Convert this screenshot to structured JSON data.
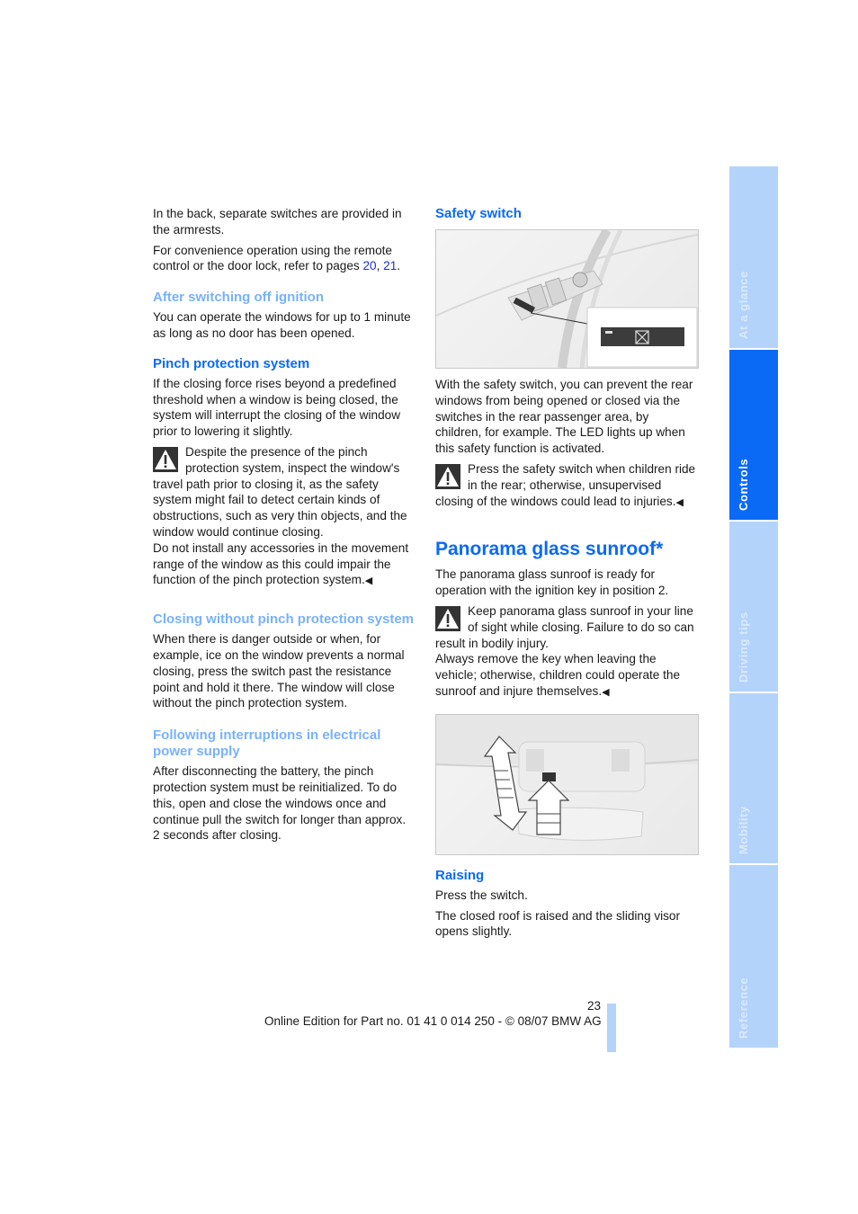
{
  "left_column": {
    "intro_p1": "In the back, separate switches are provided in the armrests.",
    "intro_p2_before": "For convenience operation using the remote control or the door lock, refer to pages ",
    "intro_p2_link1": "20",
    "intro_p2_sep": ", ",
    "intro_p2_link2": "21",
    "intro_p2_after": ".",
    "after_ignition": {
      "heading": "After switching off ignition",
      "text": "You can operate the windows for up to 1 minute as long as no door has been opened."
    },
    "pinch": {
      "heading": "Pinch protection system",
      "text": "If the closing force rises beyond a predefined threshold when a window is being closed, the system will interrupt the closing of the window prior to lowering it slightly.",
      "warning_p1": "Despite the presence of the pinch protection system, inspect the window's travel path prior to closing it, as the safety system might fail to detect certain kinds of obstructions, such as very thin objects, and the window would continue closing.",
      "warning_p2": "Do not install any accessories in the movement range of the window as this could impair the function of the pinch protection system.",
      "end_mark": "◀"
    },
    "closing_without": {
      "heading": "Closing without pinch protection system",
      "text": "When there is danger outside or when, for example, ice on the window prevents a normal closing, press the switch past the resistance point and hold it there. The window will close without the pinch protection system."
    },
    "following": {
      "heading": "Following interruptions in electrical power supply",
      "text": "After disconnecting the battery, the pinch protection system must be reinitialized. To do this, open and close the windows once and continue pull the switch for longer than approx. 2 seconds after closing."
    }
  },
  "right_column": {
    "safety_switch": {
      "heading": "Safety switch",
      "figure_icon": "window-lock-switch-illustration",
      "text": "With the safety switch, you can prevent the rear windows from being opened or closed via the switches in the rear passenger area, by children, for example. The LED lights up when this safety function is activated.",
      "warning": "Press the safety switch when children ride in the rear; otherwise, unsupervised closing of the windows could lead to injuries.",
      "end_mark": "◀"
    },
    "sunroof": {
      "heading": "Panorama glass sunroof*",
      "text": "The panorama glass sunroof is ready for operation with the ignition key in position 2.",
      "warning_p1": "Keep panorama glass sunroof in your line of sight while closing. Failure to do so can result in bodily injury.",
      "warning_p2": "Always remove the key when leaving the vehicle; otherwise, children could operate the sunroof and injure themselves.",
      "end_mark": "◀",
      "figure_icon": "sunroof-switch-illustration"
    },
    "raising": {
      "heading": "Raising",
      "p1": "Press the switch.",
      "p2": "The closed roof is raised and the sliding visor opens slightly."
    }
  },
  "side_tabs": [
    {
      "label": "At a glance",
      "active": false
    },
    {
      "label": "Controls",
      "active": true
    },
    {
      "label": "Driving tips",
      "active": false
    },
    {
      "label": "Mobility",
      "active": false
    },
    {
      "label": "Reference",
      "active": false
    }
  ],
  "footer": {
    "page_number": "23",
    "edition": "Online Edition for Part no. 01 41 0 014 250 - © 08/07 BMW AG"
  },
  "colors": {
    "heading_blue": "#0a6af5",
    "subheading_light_blue": "#79b1fb",
    "tab_inactive": "#b3d3fb",
    "tab_active": "#0a6af5",
    "link": "#1b2fd6"
  }
}
